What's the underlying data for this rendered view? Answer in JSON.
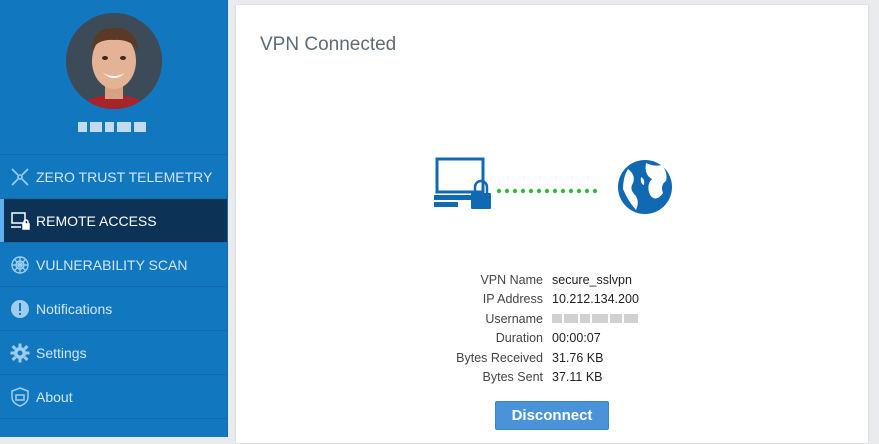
{
  "sidebar": {
    "avatar_name": "user-avatar",
    "items": [
      {
        "label": "ZERO TRUST TELEMETRY",
        "icon": "telemetry-icon",
        "active": false
      },
      {
        "label": "REMOTE ACCESS",
        "icon": "remote-access-icon",
        "active": true
      },
      {
        "label": "VULNERABILITY SCAN",
        "icon": "vulnerability-scan-icon",
        "active": false
      },
      {
        "label": "Notifications",
        "icon": "notification-icon",
        "active": false
      },
      {
        "label": "Settings",
        "icon": "gear-icon",
        "active": false
      },
      {
        "label": "About",
        "icon": "shield-icon",
        "active": false
      }
    ]
  },
  "main": {
    "title": "VPN Connected",
    "illustration": {
      "left_icon": "laptop-lock-icon",
      "right_icon": "globe-icon",
      "status_color": "#39b54a"
    },
    "info": {
      "rows": [
        {
          "label": "VPN Name",
          "value": "secure_sslvpn"
        },
        {
          "label": "IP Address",
          "value": "10.212.134.200"
        },
        {
          "label": "Username",
          "value": ""
        },
        {
          "label": "Duration",
          "value": "00:00:07"
        },
        {
          "label": "Bytes Received",
          "value": "31.76 KB"
        },
        {
          "label": "Bytes Sent",
          "value": "37.11 KB"
        }
      ]
    },
    "disconnect_label": "Disconnect"
  },
  "colors": {
    "sidebar": "#1178c0",
    "active": "#0c3356",
    "button": "#4a93d8",
    "accent_icon": "#1168b3"
  }
}
